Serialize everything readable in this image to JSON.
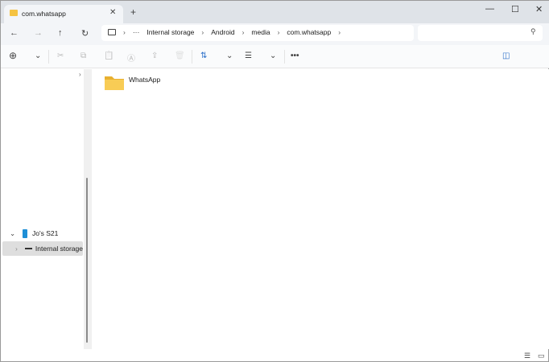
{
  "tab": {
    "title": "com.whatsapp",
    "close": "✕",
    "new": "+"
  },
  "window": {
    "minimize": "—",
    "maximize": "☐",
    "close": "✕"
  },
  "nav": {
    "back": "←",
    "forward": "→",
    "up": "↑",
    "refresh": "↻"
  },
  "breadcrumb": {
    "root_icon": "computer-icon",
    "more": "···",
    "items": [
      "Internal storage",
      "Android",
      "media",
      "com.whatsapp"
    ],
    "sep": "›"
  },
  "search": {
    "placeholder": "",
    "icon": "⚲"
  },
  "toolbar": {
    "new": "⊕",
    "cut": "✂",
    "copy": "⧉",
    "paste": "📋",
    "rename": "Ⓐ",
    "share": "⇪",
    "delete": "🗑",
    "sort": "⇅",
    "view": "☰",
    "more": "•••",
    "details": "◫",
    "chev": "⌄"
  },
  "sidebar": {
    "items": [
      {
        "label": "Jo's S21",
        "icon": "phone-icon"
      },
      {
        "label": "Internal storage",
        "icon": "drive-icon"
      }
    ]
  },
  "files": [
    {
      "name": "WhatsApp",
      "type": "folder"
    }
  ],
  "statusbar": {
    "list": "☰",
    "tiles": "▭"
  }
}
